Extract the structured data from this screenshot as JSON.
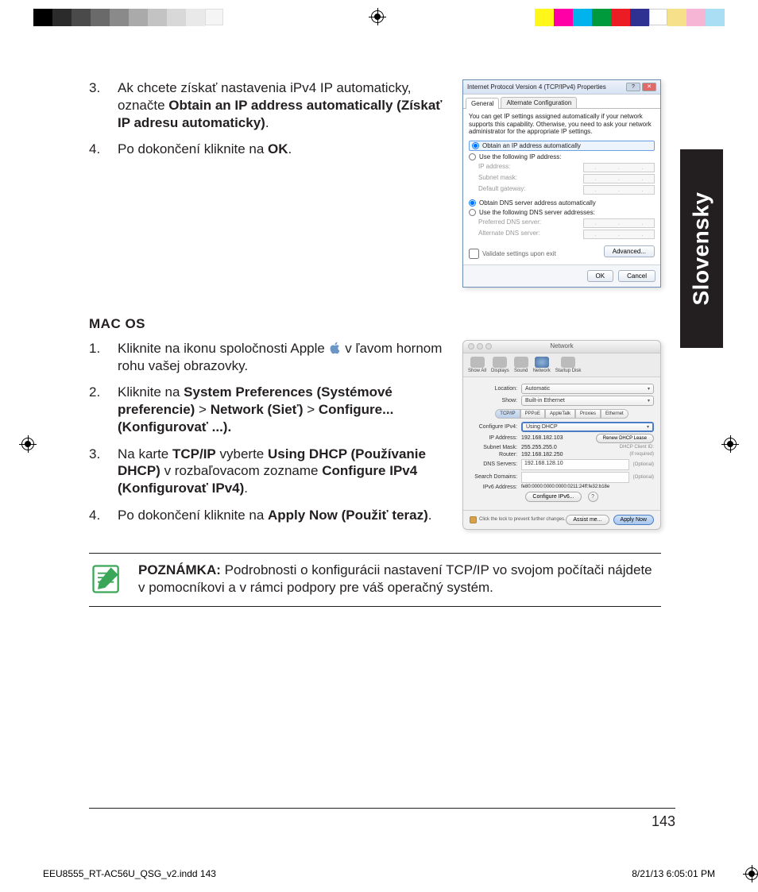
{
  "language_tab": "Slovensky",
  "page_number": "143",
  "slug": {
    "file": "EEU8555_RT-AC56U_QSG_v2.indd   143",
    "datetime": "8/21/13   6:05:01 PM"
  },
  "steps_top": [
    {
      "n": "3.",
      "pre": "Ak chcete získať nastavenia iPv4 IP automaticky, označte ",
      "bold": "Obtain an IP address automatically (Získať IP adresu automaticky)",
      "post": "."
    },
    {
      "n": "4.",
      "pre": "Po dokončení kliknite na ",
      "bold": "OK",
      "post": "."
    }
  ],
  "macos_heading": "MAC OS",
  "steps_mac": [
    {
      "n": "1.",
      "pre": "Kliknite na ikonu spoločnosti Apple ",
      "post": " v ľavom hornom rohu vašej obrazovky."
    },
    {
      "n": "2.",
      "pre": "Kliknite na ",
      "b1": "System Preferences (Systémové preferencie)",
      "gt1": " > ",
      "b2": "Network (Sieť)",
      "gt2": " > ",
      "b3": "Configure... (Konfigurovať ...).",
      "post": ""
    },
    {
      "n": "3.",
      "pre": "Na karte ",
      "b1": "TCP/IP",
      "mid1": " vyberte ",
      "b2": "Using DHCP (Používanie DHCP)",
      "mid2": " v rozbaľovacom zozname ",
      "b3": "Configure IPv4 (Konfigurovať IPv4)",
      "post": "."
    },
    {
      "n": "4.",
      "pre": "Po dokončení kliknite na  ",
      "b1": "Apply Now (Použiť teraz)",
      "post": "."
    }
  ],
  "note": {
    "label": "POZNÁMKA:",
    "text": "   Podrobnosti o konfigurácii nastavení TCP/IP vo svojom počítači nájdete v pomocníkovi a v rámci podpory pre váš operačný systém."
  },
  "win_dialog": {
    "title": "Internet Protocol Version 4 (TCP/IPv4) Properties",
    "tab_general": "General",
    "tab_alt": "Alternate Configuration",
    "desc": "You can get IP settings assigned automatically if your network supports this capability. Otherwise, you need to ask your network administrator for the appropriate IP settings.",
    "r_auto_ip": "Obtain an IP address automatically",
    "r_use_ip": "Use the following IP address:",
    "f_ip": "IP address:",
    "f_mask": "Subnet mask:",
    "f_gw": "Default gateway:",
    "r_auto_dns": "Obtain DNS server address automatically",
    "r_use_dns": "Use the following DNS server addresses:",
    "f_pdns": "Preferred DNS server:",
    "f_adns": "Alternate DNS server:",
    "chk_validate": "Validate settings upon exit",
    "btn_adv": "Advanced...",
    "btn_ok": "OK",
    "btn_cancel": "Cancel"
  },
  "mac_dialog": {
    "title": "Network",
    "tb": [
      "Show All",
      "Displays",
      "Sound",
      "Network",
      "Startup Disk"
    ],
    "location_lbl": "Location:",
    "location_val": "Automatic",
    "show_lbl": "Show:",
    "show_val": "Built-in Ethernet",
    "tabs": [
      "TCP/IP",
      "PPPoE",
      "AppleTalk",
      "Proxies",
      "Ethernet"
    ],
    "cfg_lbl": "Configure IPv4:",
    "cfg_val": "Using DHCP",
    "ip_lbl": "IP Address:",
    "ip_val": "192.168.182.103",
    "renew": "Renew DHCP Lease",
    "mask_lbl": "Subnet Mask:",
    "mask_val": "255.255.255.0",
    "dhcp_id_lbl": "DHCP Client ID:",
    "router_lbl": "Router:",
    "router_val": "192.168.182.250",
    "req": "(if required)",
    "dns_lbl": "DNS Servers:",
    "dns_val": "192.168.128.10",
    "opt": "(Optional)",
    "search_lbl": "Search Domains:",
    "ipv6_lbl": "IPv6 Address:",
    "ipv6_val": "fe80:0000:0000:0000:0211:24ff:fe32:b18e",
    "cfg6_btn": "Configure IPv6...",
    "lock_text": "Click the lock to prevent further changes.",
    "assist": "Assist me...",
    "apply": "Apply Now"
  }
}
